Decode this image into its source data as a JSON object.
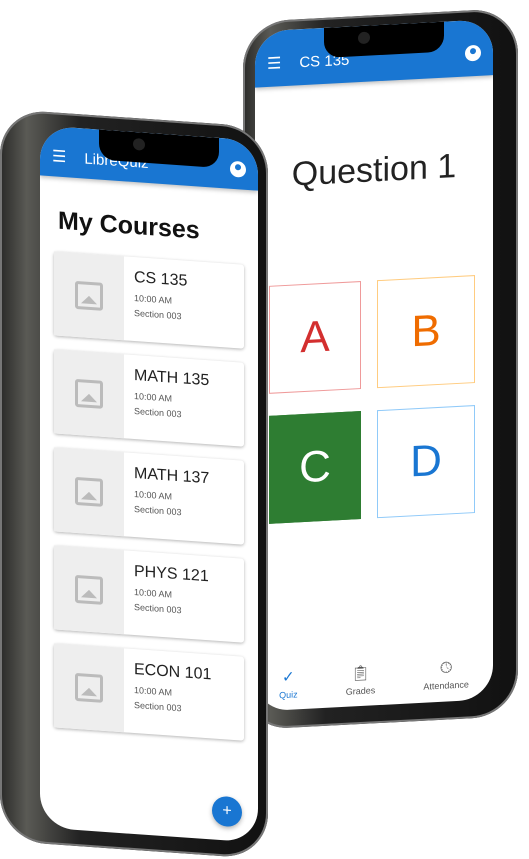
{
  "quiz_phone": {
    "title": "CS 135",
    "question": "Question 1",
    "answers": [
      {
        "label": "A",
        "color": "#d32f2f",
        "bg": "#fff"
      },
      {
        "label": "B",
        "color": "#ef6c00",
        "bg": "#fff"
      },
      {
        "label": "C",
        "color": "#fff",
        "bg": "#2e7d32"
      },
      {
        "label": "D",
        "color": "#1976d2",
        "bg": "#fff"
      }
    ],
    "nav": [
      {
        "label": "Quiz",
        "icon": "check-icon"
      },
      {
        "label": "Grades",
        "icon": "clipboard-icon"
      },
      {
        "label": "Attendance",
        "icon": "clock-icon"
      }
    ]
  },
  "courses_phone": {
    "title": "LibreQuiz",
    "heading": "My Courses",
    "courses": [
      {
        "name": "CS 135",
        "time": "10:00 AM",
        "section": "Section 003"
      },
      {
        "name": "MATH 135",
        "time": "10:00 AM",
        "section": "Section 003"
      },
      {
        "name": "MATH 137",
        "time": "10:00 AM",
        "section": "Section 003"
      },
      {
        "name": "PHYS 121",
        "time": "10:00 AM",
        "section": "Section 003"
      },
      {
        "name": "ECON 101",
        "time": "10:00 AM",
        "section": "Section 003"
      }
    ],
    "fab": "+"
  },
  "accent": "#1976d2"
}
